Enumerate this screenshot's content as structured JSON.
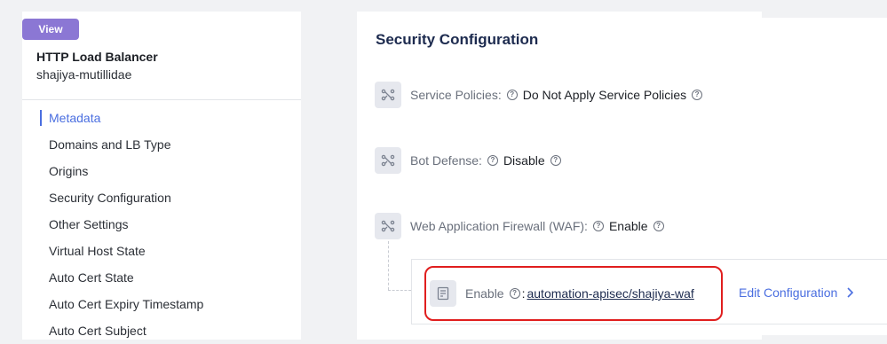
{
  "header": {
    "badge": "View",
    "resource_type": "HTTP Load Balancer",
    "resource_name": "shajiya-mutillidae"
  },
  "nav": {
    "items": [
      {
        "label": "Metadata",
        "active": true
      },
      {
        "label": "Domains and LB Type"
      },
      {
        "label": "Origins"
      },
      {
        "label": "Security Configuration"
      },
      {
        "label": "Other Settings"
      },
      {
        "label": "Virtual Host State"
      },
      {
        "label": "Auto Cert State"
      },
      {
        "label": "Auto Cert Expiry Timestamp"
      },
      {
        "label": "Auto Cert Subject"
      }
    ]
  },
  "section": {
    "title": "Security Configuration",
    "rows": [
      {
        "label": "Service Policies:",
        "value": "Do Not Apply Service Policies",
        "icon": "branch-icon"
      },
      {
        "label": "Bot Defense:",
        "value": "Disable",
        "icon": "branch-icon"
      },
      {
        "label": "Web Application Firewall (WAF):",
        "value": "Enable",
        "icon": "branch-icon"
      }
    ],
    "sub_item": {
      "label": "Enable",
      "value": "automation-apisec/shajiya-waf",
      "icon": "document-icon"
    },
    "edit_label": "Edit Configuration"
  },
  "colors": {
    "accent": "#4a6ee0",
    "badge": "#8b77d4",
    "highlight": "#e01e1e"
  }
}
